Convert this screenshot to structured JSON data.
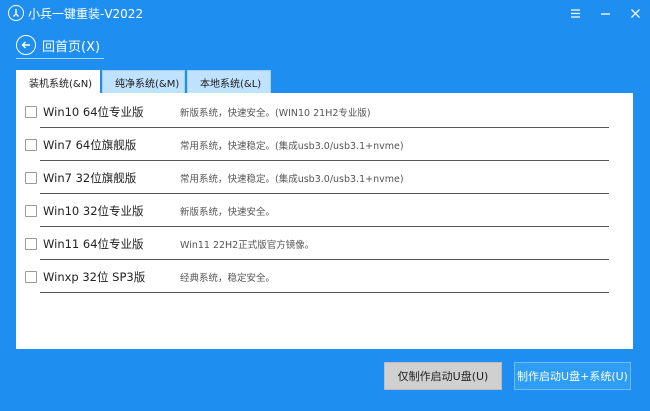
{
  "window": {
    "title": "小兵一键重装-V2022"
  },
  "nav": {
    "back_label": "回首页(X)"
  },
  "tabs": [
    {
      "label": "装机系统(&N)",
      "active": true
    },
    {
      "label": "纯净系统(&M)",
      "active": false
    },
    {
      "label": "本地系统(&L)",
      "active": false
    }
  ],
  "systems": [
    {
      "name": "Win10 64位专业版",
      "desc": "新版系统，快速安全。(WIN10 21H2专业版)",
      "checked": false
    },
    {
      "name": "Win7 64位旗舰版",
      "desc": "常用系统，快速稳定。(集成usb3.0/usb3.1+nvme)",
      "checked": false
    },
    {
      "name": "Win7 32位旗舰版",
      "desc": "常用系统，快速稳定。(集成usb3.0/usb3.1+nvme)",
      "checked": false
    },
    {
      "name": "Win10 32位专业版",
      "desc": "新版系统，快速安全。",
      "checked": false
    },
    {
      "name": "Win11 64位专业版",
      "desc": "Win11 22H2正式版官方镜像。",
      "checked": false
    },
    {
      "name": "Winxp 32位 SP3版",
      "desc": "经典系统，稳定安全。",
      "checked": false
    }
  ],
  "buttons": {
    "make_usb": "仅制作启动U盘(U)",
    "make_usb_system": "制作启动U盘+系统(U)"
  },
  "colors": {
    "background": "#1e8ff0",
    "panel": "#ffffff",
    "tab_inactive": "#bfe2ff",
    "primary_button": "#2d9df5",
    "secondary_button": "#d0d0d0"
  }
}
